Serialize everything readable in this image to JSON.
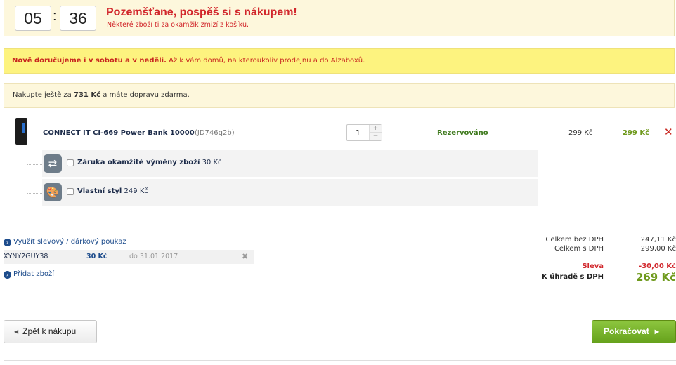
{
  "timer": {
    "minutes": "05",
    "separator": ":",
    "seconds": "36",
    "title": "Pozemšťane, pospěš si s nákupem!",
    "subtitle": "Některé zboží ti za okamžik zmizí z košíku."
  },
  "promo": {
    "bold": "Nově doručujeme i v sobotu a v neděli.",
    "text": " Až k vám domů, na kteroukoliv prodejnu a do Alzaboxů."
  },
  "shipping": {
    "prefix": "Nakupte ještě za ",
    "amount": "731 Kč",
    "middle": " a máte ",
    "link": "dopravu zdarma",
    "suffix": "."
  },
  "cart": {
    "item": {
      "name": "CONNECT IT CI-669 Power Bank 10000",
      "code": "(JD746q2b)",
      "quantity": "1",
      "status": "Rezervováno",
      "unit_price": "299 Kč",
      "total_price": "299 Kč",
      "remove_glyph": "✕"
    },
    "services": [
      {
        "name": "Záruka okamžité výměny zboží",
        "price": "30 Kč",
        "icon": "exchange-icon",
        "glyph": "⇄"
      },
      {
        "name": "Vlastní styl",
        "price": "249 Kč",
        "icon": "palette-icon",
        "glyph": "🎨"
      }
    ]
  },
  "voucher": {
    "link": "Využít slevový / dárkový poukaz",
    "code": "XYNY2GUY38",
    "value": "30 Kč",
    "valid": "do 31.01.2017",
    "remove": "✖"
  },
  "add_item": {
    "link": "Přidat zboží"
  },
  "summary": {
    "without_vat_label": "Celkem bez DPH",
    "without_vat": "247,11 Kč",
    "with_vat_label": "Celkem s DPH",
    "with_vat": "299,00 Kč",
    "discount_label": "Sleva",
    "discount": "-30,00 Kč",
    "to_pay_label": "K úhradě s DPH",
    "to_pay": "269 Kč"
  },
  "buttons": {
    "back": "Zpět k nákupu",
    "next": "Pokračovat"
  },
  "colors": {
    "accent_red": "#d1262b",
    "accent_green": "#6f9a1d",
    "link_blue": "#1d4c8c"
  }
}
